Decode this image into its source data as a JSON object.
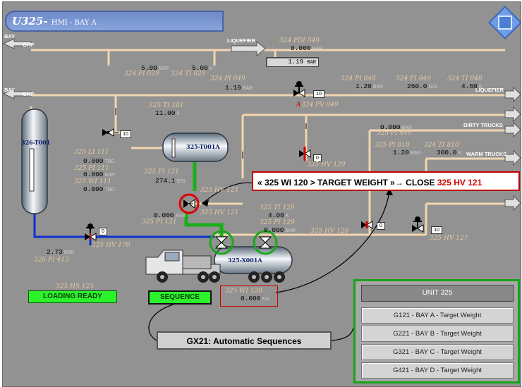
{
  "header": {
    "title": "U325-",
    "subtitle": "HMI - BAY A"
  },
  "pipes": {
    "bay_top": "BAY",
    "ghp_top": "GHP",
    "liquefier_top": "LIQUEFIER",
    "bay_mid": "BAY",
    "ghp_mid": "GHP",
    "liquefier_right": "LIQUEFIER",
    "dirty_trucks": "DIRTY TRUCKS",
    "warm_trucks": "WARM TRUCKS"
  },
  "vessels": {
    "t001": "326-T001",
    "t001a": "325-T001A",
    "x001a": "325-X001A"
  },
  "instruments": {
    "pdi049": {
      "tag": "324 PDI 049",
      "value": "0.000",
      "unit": "BAR"
    },
    "setpoint": {
      "value": "1.19",
      "unit": "BAR"
    },
    "pi029": {
      "tag": "324 PI 029",
      "value": "5.00",
      "unit": "BAR"
    },
    "ti029": {
      "tag": "324 TI 029",
      "value": "5.00",
      "unit": "K"
    },
    "pi049": {
      "tag": "324 PI 049",
      "value": "1.19",
      "unit": "BAR"
    },
    "pi048": {
      "tag": "324 PI 048",
      "value": "1.20",
      "unit": "BAR"
    },
    "fi049": {
      "tag": "324 FI 049",
      "value": "260.0",
      "unit": "G/S"
    },
    "ti048": {
      "tag": "324 TI 048",
      "value": "4.60",
      "unit": "K"
    },
    "pv049": {
      "tag": "324 PV 049",
      "prefix": "A",
      "pos": "10"
    },
    "ti101": {
      "tag": "325 TI 101",
      "value": "11.00",
      "unit": "K"
    },
    "v_upper": {
      "pos": "10"
    },
    "li111": {
      "tag": "325 LI 111",
      "value": "0.000",
      "unit": "TBD"
    },
    "pi111": {
      "tag": "325 PI 111",
      "value": "0.000",
      "unit": "BAR"
    },
    "wi111": {
      "tag": "325 WI 111",
      "value": "0.000",
      "unit": "TBD"
    },
    "fi121": {
      "tag": "325 FI 121",
      "value": "274.1",
      "unit": "G/S"
    },
    "pi449": {
      "tag": "325 PI 449",
      "value": "0.000",
      "unit": "BAR"
    },
    "pi810": {
      "tag": "325 PI 810",
      "value": "1.20",
      "unit": "BAR"
    },
    "ti810": {
      "tag": "324 TI 810",
      "value": "300.0",
      "unit": "K"
    },
    "hv129": {
      "tag": "325 HV 129",
      "pos": "0"
    },
    "hv121": {
      "tag": "325 HV 121",
      "tag2": "325 HV 121",
      "pos": "I"
    },
    "pi121": {
      "tag": "325 PI 121",
      "value": "0.000",
      "unit": "BAR"
    },
    "ti129": {
      "tag": "325 TI 129",
      "value": "4.00",
      "unit": "K"
    },
    "pi129": {
      "tag": "325 PI 129",
      "value": "0.000",
      "unit": "BAR"
    },
    "hv128": {
      "tag": "325 HV 128",
      "pos": "0"
    },
    "hv127": {
      "tag": "325 HV 127",
      "pos": "10"
    },
    "hv170": {
      "tag": "325 HV 170",
      "pos": "0"
    },
    "pi413": {
      "tag": "326 PI 413",
      "value": "2.73",
      "unit": "BAR"
    },
    "hs125": {
      "tag": "325 HS 125"
    },
    "wi120": {
      "tag": "325 WI 120",
      "value": "0.000",
      "unit": "KG"
    }
  },
  "status": {
    "loading_ready": "LOADING READY",
    "sequence": "SEQUENCE"
  },
  "callouts": {
    "interlock_prefix": "« 325 WI 120 > TARGET WEIGHT »",
    "interlock_arrow": "→",
    "interlock_action": " CLOSE ",
    "interlock_target": "325 HV 121",
    "autoseq": "GX21: Automatic Sequences"
  },
  "unit_panel": {
    "header": "UNIT 325",
    "buttons": [
      "G121 - BAY A - Target Weight",
      "G221 - BAY B - Target Weight",
      "G321 - BAY C - Target Weight",
      "G421 - BAY D - Target Weight"
    ]
  },
  "colors": {
    "background": "#929292",
    "pipe_gas": "#f2d6b0",
    "pipe_liquid": "#1030d0",
    "flow_highlight": "#18b018",
    "alarm_red": "#d00000",
    "ok_green": "#2cf22c"
  }
}
